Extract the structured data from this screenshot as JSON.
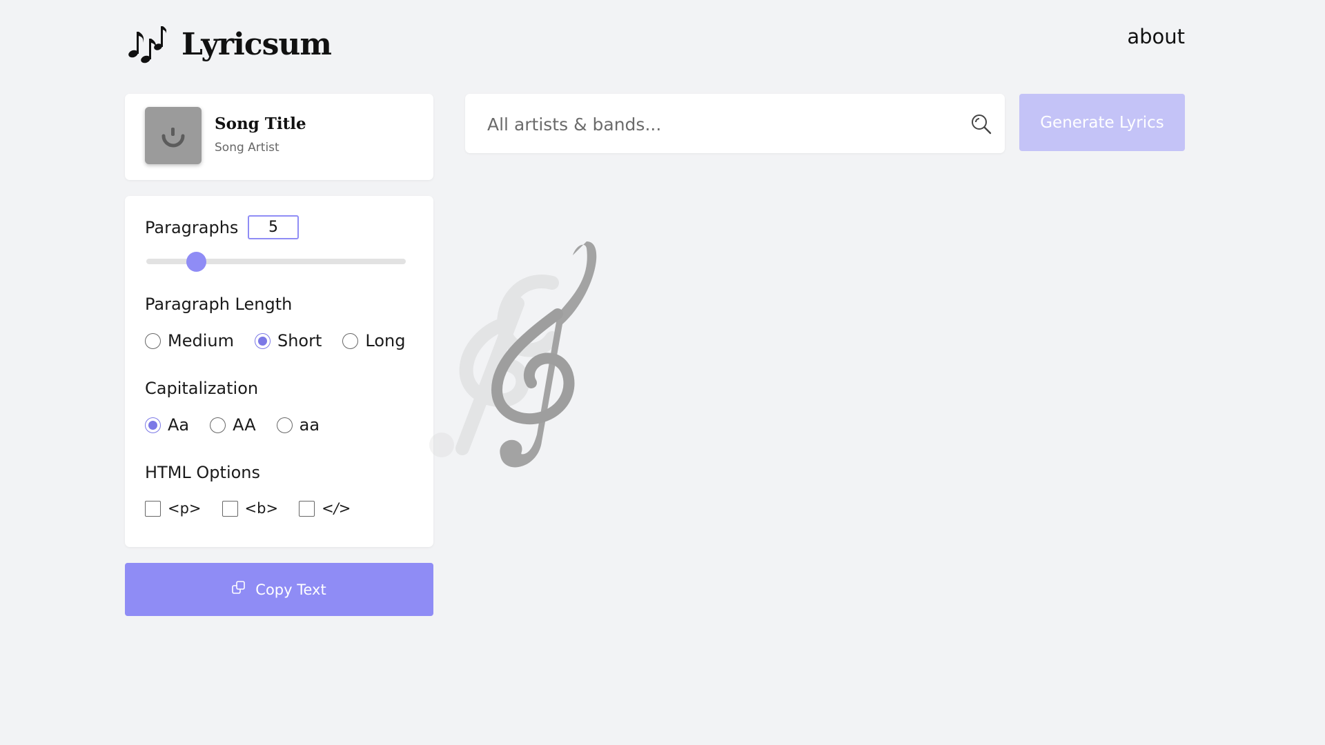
{
  "header": {
    "app_title": "Lyricsum",
    "about_link": "about"
  },
  "song": {
    "title": "Song Title",
    "artist": "Song Artist"
  },
  "options": {
    "paragraphs_label": "Paragraphs",
    "paragraphs_value": "5",
    "paragraphs_slider_fraction": 0.2,
    "length_label": "Paragraph Length",
    "length_options": [
      {
        "label": "Medium",
        "checked": false
      },
      {
        "label": "Short",
        "checked": true
      },
      {
        "label": "Long",
        "checked": false
      }
    ],
    "capitalization_label": "Capitalization",
    "capitalization_options": [
      {
        "label": "Aa",
        "checked": true
      },
      {
        "label": "AA",
        "checked": false
      },
      {
        "label": "aa",
        "checked": false
      }
    ],
    "html_label": "HTML Options",
    "html_options": [
      {
        "label": "<p>",
        "checked": false
      },
      {
        "label": "<b>",
        "checked": false
      },
      {
        "label": "</>",
        "checked": false
      }
    ]
  },
  "copy_button": {
    "label": "Copy Text",
    "icon": "copy-icon"
  },
  "search": {
    "placeholder": "All artists & bands...",
    "value": "",
    "icon": "search-icon"
  },
  "generate_button": {
    "label": "Generate Lyrics"
  },
  "colors": {
    "accent": "#8f8cf5",
    "accent_disabled": "#c4c3f7",
    "background": "#f2f3f5"
  }
}
